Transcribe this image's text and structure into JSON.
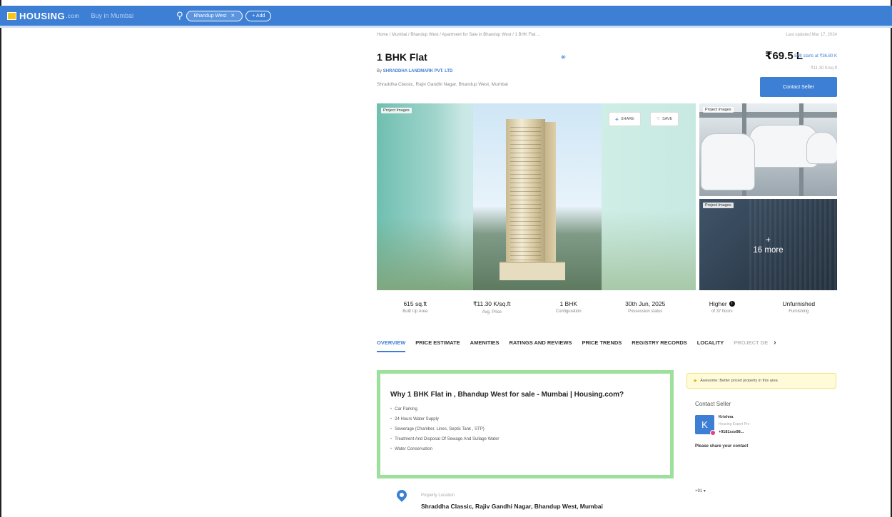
{
  "header": {
    "logo_text": "HOUSING",
    "logo_suffix": ".com",
    "city": "Buy in Mumbai",
    "search_chip": "Bhandup West",
    "add_label": "+ Add"
  },
  "listing": {
    "breadcrumb": "Home / Mumbai / Bhandup West / Apartment for Sale in Bhandup West / 1 BHK Flat ...",
    "posted": "Last updated Mar 17, 2024",
    "title": "1 BHK Flat",
    "price": "₹69.5 L",
    "emi": "EMI starts at ₹36.80 K",
    "per_sqft": "₹11.30 K/sq.ft",
    "builder_prefix": "By",
    "builder": "SHRADDHA LANDMARK PVT. LTD",
    "address": "Shraddha Classic, Rajiv Gandhi Nagar, Bhandup West, Mumbai",
    "contact_button": "Contact Seller"
  },
  "gallery": {
    "main_label": "Project Images",
    "side_top_label": "Project Images",
    "side_bottom_label": "Project Images",
    "share_label": "SHARE",
    "save_label": "SAVE",
    "more_plus": "+",
    "more_label": "16 more"
  },
  "stats": [
    {
      "value": "615 sq.ft",
      "label": "Built Up Area"
    },
    {
      "value": "₹11.30 K/sq.ft",
      "label": "Avg. Price"
    },
    {
      "value": "1 BHK",
      "label": "Configuration"
    },
    {
      "value": "30th Jun, 2025",
      "label": "Possession status"
    },
    {
      "value": "Higher",
      "label": "of 37 floors",
      "info": "i"
    },
    {
      "value": "Unfurnished",
      "label": "Furnishing"
    }
  ],
  "tabs": [
    {
      "label": "OVERVIEW"
    },
    {
      "label": "PRICE ESTIMATE"
    },
    {
      "label": "AMENITIES"
    },
    {
      "label": "RATINGS AND REVIEWS"
    },
    {
      "label": "PRICE TRENDS"
    },
    {
      "label": "REGISTRY RECORDS"
    },
    {
      "label": "LOCALITY"
    },
    {
      "label": "PROJECT DE"
    }
  ],
  "tabs_more": "›",
  "why": {
    "title": "Why 1 BHK Flat in , Bhandup West for sale - Mumbai | Housing.com?",
    "items": [
      "Car Parking",
      "24 Hours Water Supply",
      "Sewerage (Chamber, Lines, Septic Tank , STP)",
      "Treatment And Disposal Of Sewage And Sullage Water",
      "Water Conservation"
    ]
  },
  "sidebar": {
    "awesome_text": "Awesome: Better priced property in this area",
    "contact_title": "Contact Seller",
    "avatar_letter": "K",
    "agent_name": "Krishna",
    "agent_sub": "Housing Expert Pro",
    "agent_phone": "+9181xxx98...",
    "share_contact": "Please share your contact",
    "country_code": "+91 ▾"
  },
  "location": {
    "label": "Property Location",
    "text": "Shraddha Classic, Rajiv Gandhi Nagar, Bhandup West, Mumbai"
  },
  "colors": {
    "brand": "#3d7fd4",
    "highlight_border": "#9ce09b",
    "notice_bg": "#fffbd8"
  },
  "icons": {
    "search": "search-icon",
    "share": "share-icon",
    "save": "heart-icon",
    "pin": "location-pin-icon",
    "info": "info-icon"
  }
}
